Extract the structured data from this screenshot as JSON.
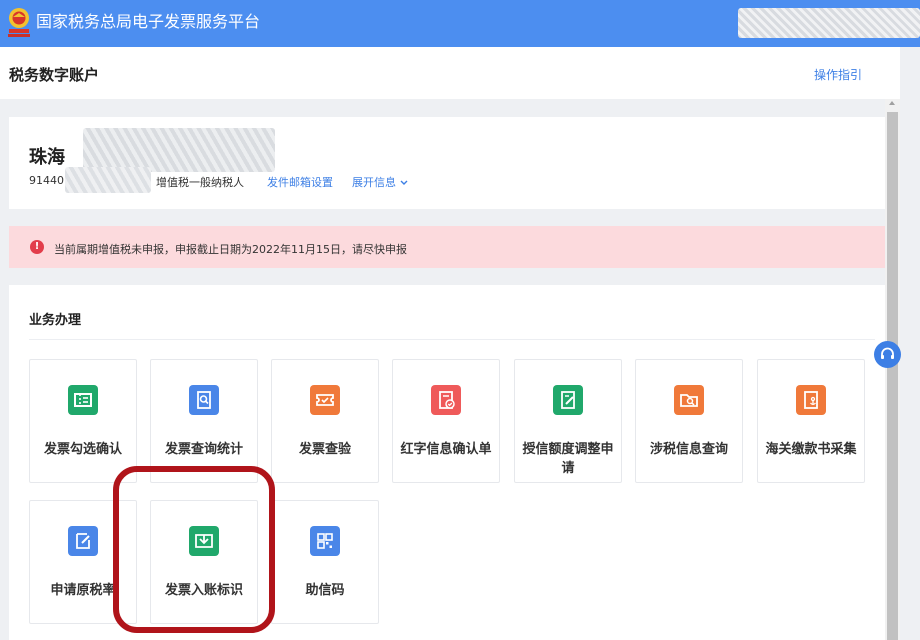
{
  "header": {
    "brand": "国家税务总局电子发票服务平台",
    "emblem_icon": "tax-emblem-icon"
  },
  "subheader": {
    "title": "税务数字账户",
    "guide_link": "操作指引"
  },
  "account": {
    "company_name_visible": "珠海",
    "tax_id_visible": "91440",
    "taxpayer_type": "增值税一般纳税人",
    "mail_setting_link": "发件邮箱设置",
    "expand_link": "展开信息"
  },
  "alert": {
    "icon": "exclamation-icon",
    "message": "当前属期增值税未申报，申报截止日期为2022年11月15日，请尽快申报"
  },
  "business": {
    "title": "业务办理",
    "tiles": [
      {
        "label": "发票勾选确认",
        "icon": "ticket-icon",
        "color": "#20a86b"
      },
      {
        "label": "发票查询统计",
        "icon": "doc-search-icon",
        "color": "#4a86e8"
      },
      {
        "label": "发票查验",
        "icon": "ticket-check-icon",
        "color": "#f0793a"
      },
      {
        "label": "红字信息确认单",
        "icon": "red-doc-check-icon",
        "color": "#ef5a5a"
      },
      {
        "label": "授信额度调整申请",
        "icon": "edit-doc-icon",
        "color": "#20a86b"
      },
      {
        "label": "涉税信息查询",
        "icon": "folder-search-icon",
        "color": "#f0793a"
      },
      {
        "label": "海关缴款书采集",
        "icon": "anchor-doc-icon",
        "color": "#f0793a"
      },
      {
        "label": "申请原税率",
        "icon": "pencil-doc-icon",
        "color": "#4a86e8"
      },
      {
        "label": "发票入账标识",
        "icon": "inbox-mark-icon",
        "color": "#20a86b"
      },
      {
        "label": "助信码",
        "icon": "qr-code-icon",
        "color": "#4a86e8"
      }
    ]
  },
  "support_icon": "headset-icon"
}
